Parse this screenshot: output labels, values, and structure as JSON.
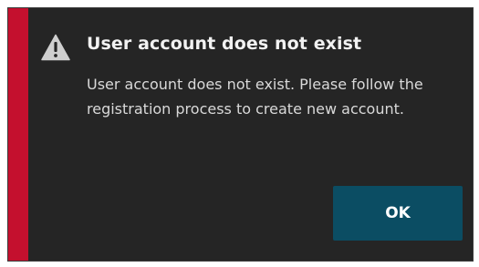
{
  "dialog": {
    "title": "User account does not exist",
    "message": "User account does not exist. Please follow the registration process to create new account.",
    "ok_label": "OK",
    "icon": "warning-icon"
  },
  "colors": {
    "accent": "#c4102e",
    "background": "#252525",
    "button": "#0b4d63",
    "icon": "#cfcfcf"
  }
}
